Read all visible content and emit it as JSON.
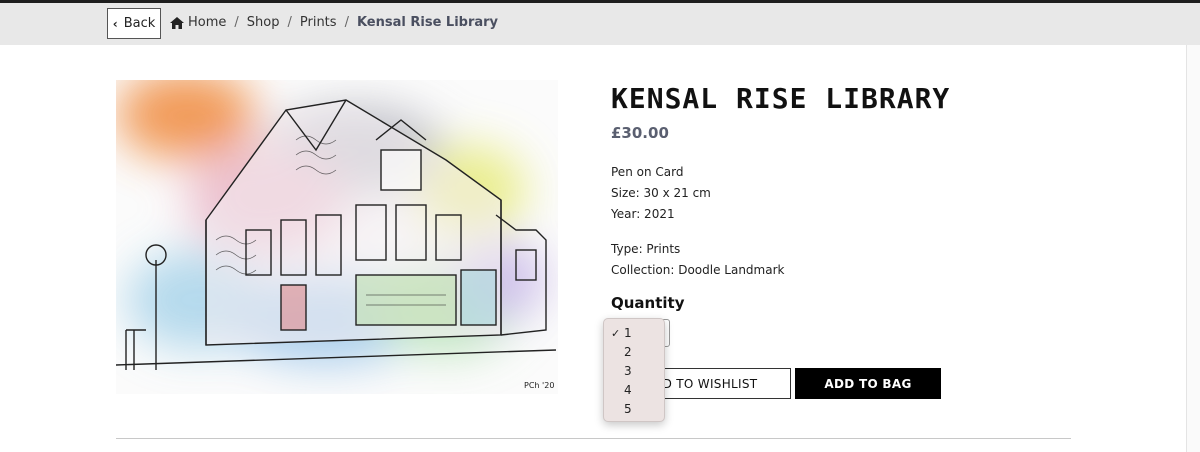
{
  "nav": {
    "back_label": "Back",
    "breadcrumbs": [
      "Home",
      "Shop",
      "Prints",
      "Kensal Rise Library"
    ],
    "separator": "/"
  },
  "product": {
    "title": "Kensal Rise Library",
    "price": "£30.00",
    "medium": "Pen on Card",
    "size": "Size: 30 x 21 cm",
    "year": "Year: 2021",
    "type": "Type: Prints",
    "collection": "Collection: Doodle Landmark",
    "image_alt": "Kensal Rise Library doodle print",
    "signature": "PCh '20"
  },
  "quantity": {
    "label": "Quantity",
    "selected": "1",
    "options": [
      "1",
      "2",
      "3",
      "4",
      "5"
    ]
  },
  "actions": {
    "wishlist_label": "ADD TO WISHLIST",
    "bag_label": "ADD TO BAG"
  },
  "colors": {
    "title": "#111111",
    "price": "#5a5f70",
    "bag_button_bg": "#000000",
    "breadcrumb_bar": "#e8e8e8",
    "dropdown_bg": "#ece3e2"
  },
  "icons": {
    "back": "chevron-left-icon",
    "home": "home-icon",
    "select": "chevron-down-icon",
    "selected_option": "checkmark-icon"
  }
}
